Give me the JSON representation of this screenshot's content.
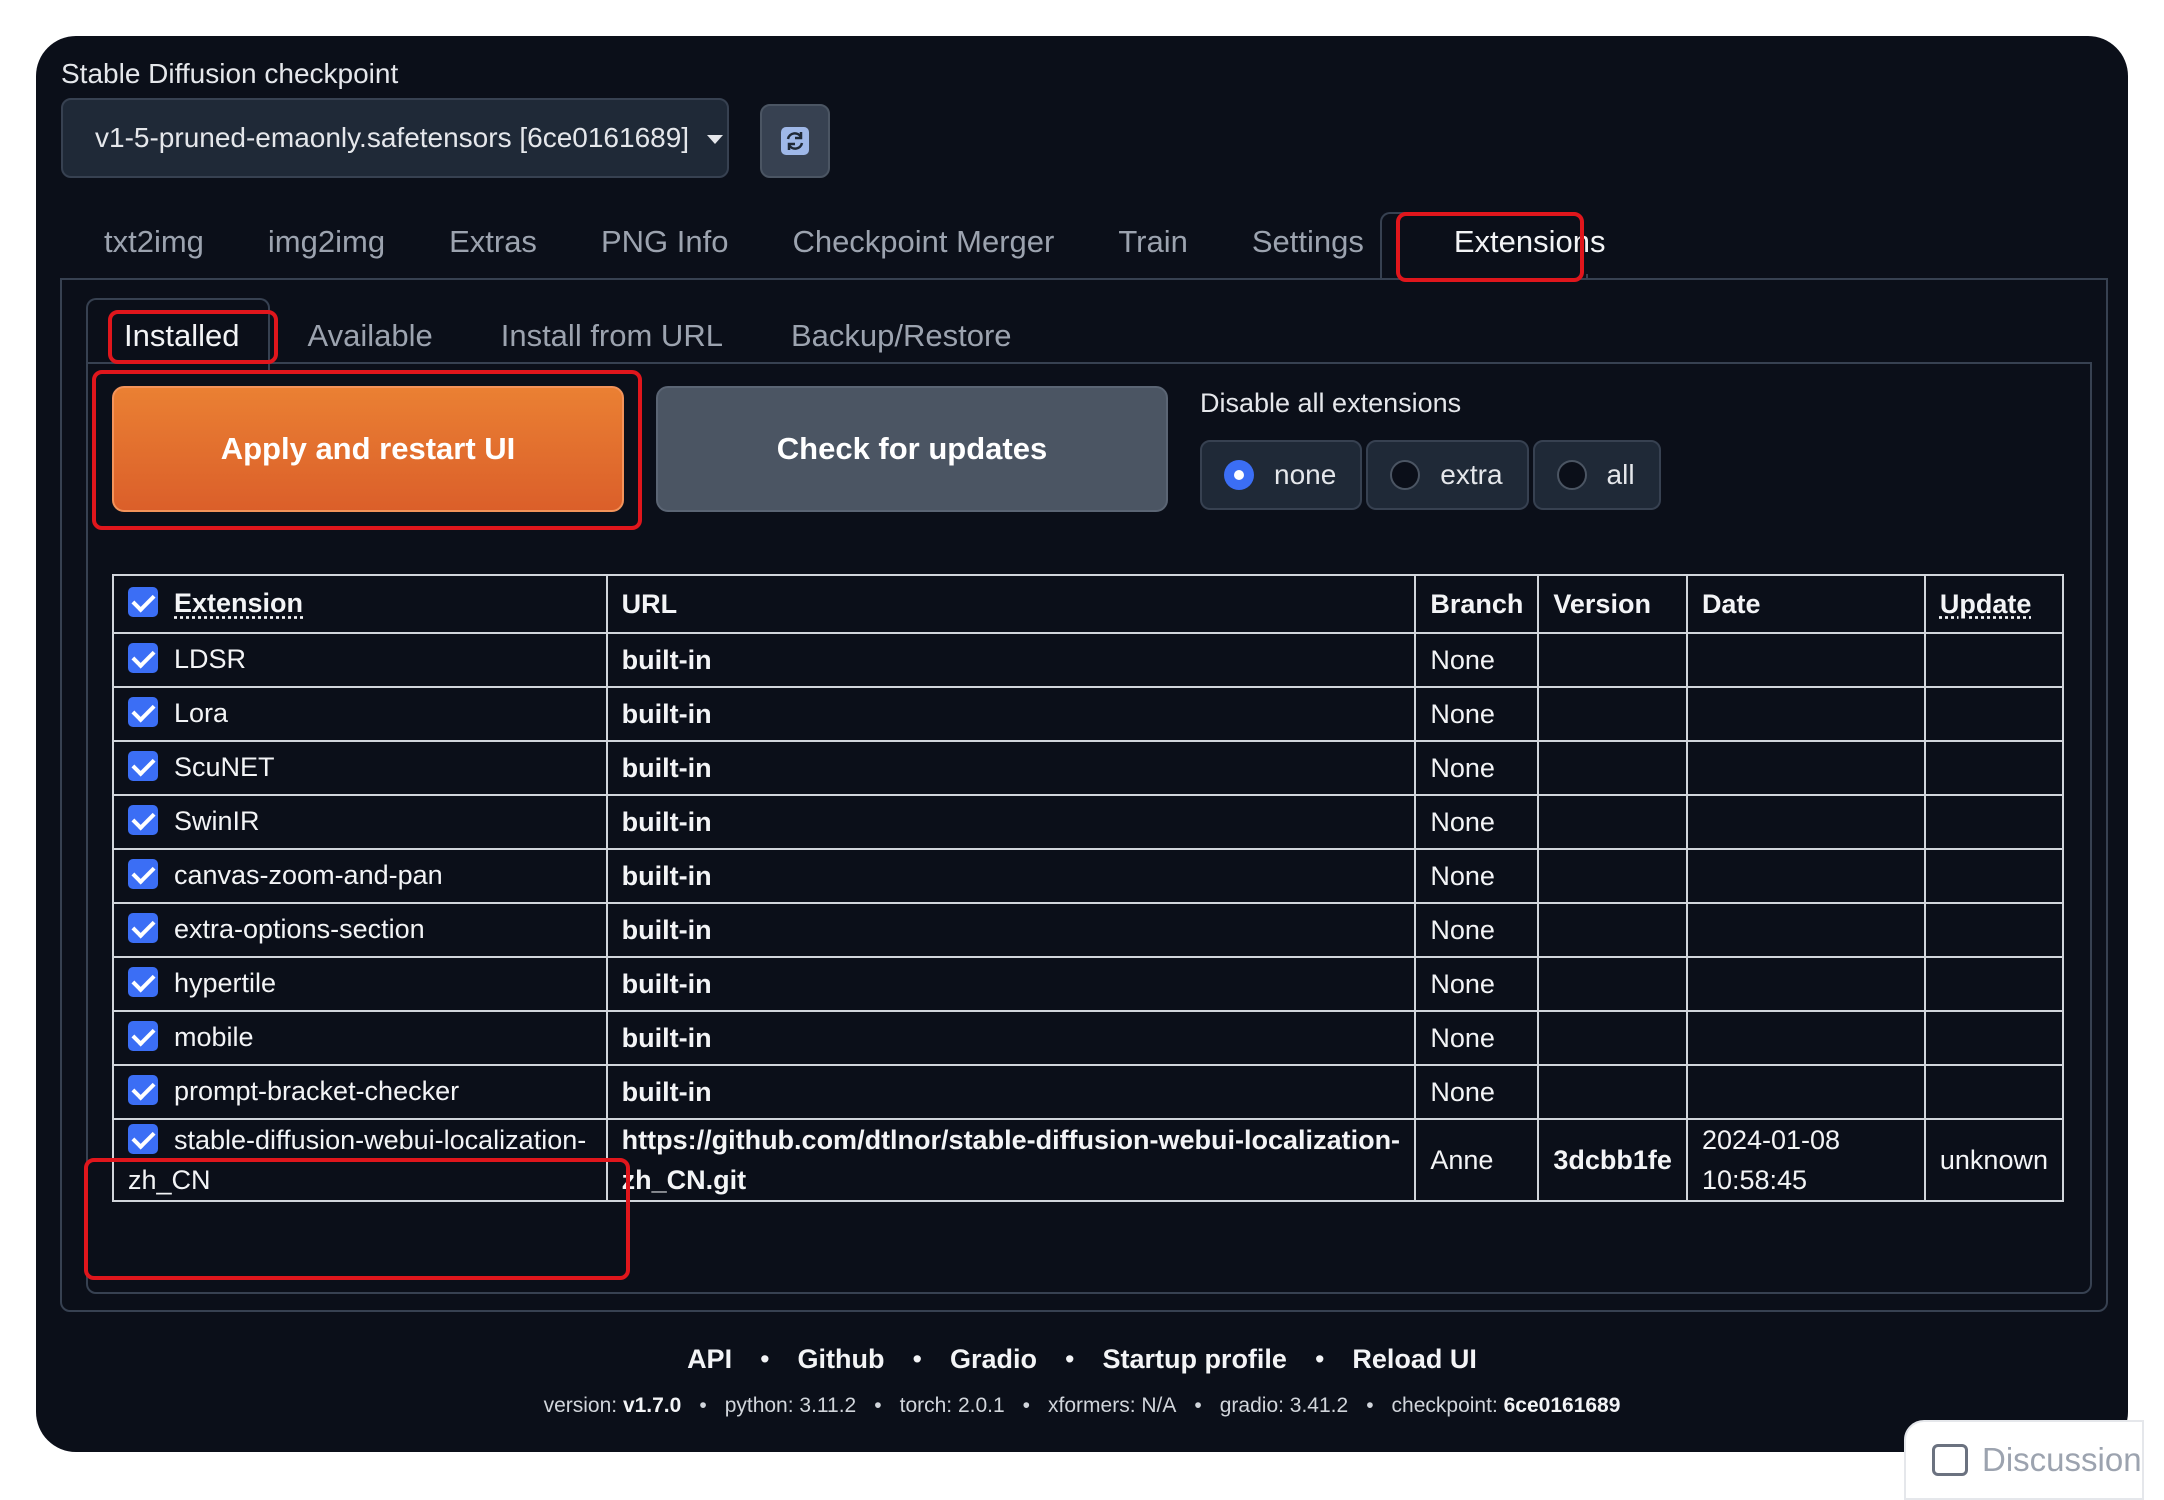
{
  "checkpoint": {
    "label": "Stable Diffusion checkpoint",
    "value": "v1-5-pruned-emaonly.safetensors [6ce0161689]"
  },
  "main_tabs": [
    "txt2img",
    "img2img",
    "Extras",
    "PNG Info",
    "Checkpoint Merger",
    "Train",
    "Settings",
    "Extensions"
  ],
  "sub_tabs": [
    "Installed",
    "Available",
    "Install from URL",
    "Backup/Restore"
  ],
  "buttons": {
    "apply": "Apply and restart UI",
    "check": "Check for updates"
  },
  "disable": {
    "label": "Disable all extensions",
    "options": [
      "none",
      "extra",
      "all"
    ],
    "selected": "none"
  },
  "table": {
    "headers": [
      "Extension",
      "URL",
      "Branch",
      "Version",
      "Date",
      "Update"
    ],
    "rows": [
      {
        "name": "LDSR",
        "url": "built-in",
        "branch": "None",
        "version": "",
        "date": "",
        "update": ""
      },
      {
        "name": "Lora",
        "url": "built-in",
        "branch": "None",
        "version": "",
        "date": "",
        "update": ""
      },
      {
        "name": "ScuNET",
        "url": "built-in",
        "branch": "None",
        "version": "",
        "date": "",
        "update": ""
      },
      {
        "name": "SwinIR",
        "url": "built-in",
        "branch": "None",
        "version": "",
        "date": "",
        "update": ""
      },
      {
        "name": "canvas-zoom-and-pan",
        "url": "built-in",
        "branch": "None",
        "version": "",
        "date": "",
        "update": ""
      },
      {
        "name": "extra-options-section",
        "url": "built-in",
        "branch": "None",
        "version": "",
        "date": "",
        "update": ""
      },
      {
        "name": "hypertile",
        "url": "built-in",
        "branch": "None",
        "version": "",
        "date": "",
        "update": ""
      },
      {
        "name": "mobile",
        "url": "built-in",
        "branch": "None",
        "version": "",
        "date": "",
        "update": ""
      },
      {
        "name": "prompt-bracket-checker",
        "url": "built-in",
        "branch": "None",
        "version": "",
        "date": "",
        "update": ""
      },
      {
        "name": "stable-diffusion-webui-localization-zh_CN",
        "url": "https://github.com/dtlnor/stable-diffusion-webui-localization-zh_CN.git",
        "branch": "Anne",
        "version": "3dcbb1fe",
        "date": "2024-01-08 10:58:45",
        "update": "unknown"
      }
    ]
  },
  "footer": {
    "links": [
      "API",
      "Github",
      "Gradio",
      "Startup profile",
      "Reload UI"
    ],
    "versions": [
      {
        "label": "version: ",
        "value": "v1.7.0"
      },
      {
        "label": "python: 3.11.2",
        "value": ""
      },
      {
        "label": "torch: 2.0.1",
        "value": ""
      },
      {
        "label": "xformers: N/A",
        "value": ""
      },
      {
        "label": "gradio: 3.41.2",
        "value": ""
      },
      {
        "label": "checkpoint: ",
        "value": "6ce0161689"
      }
    ]
  },
  "discussion": "Discussion",
  "colors": {
    "background": "#0b0f19",
    "accent_orange": "#e5762f",
    "checkbox_blue": "#3b6ef5",
    "highlight_red": "#e0161c"
  }
}
